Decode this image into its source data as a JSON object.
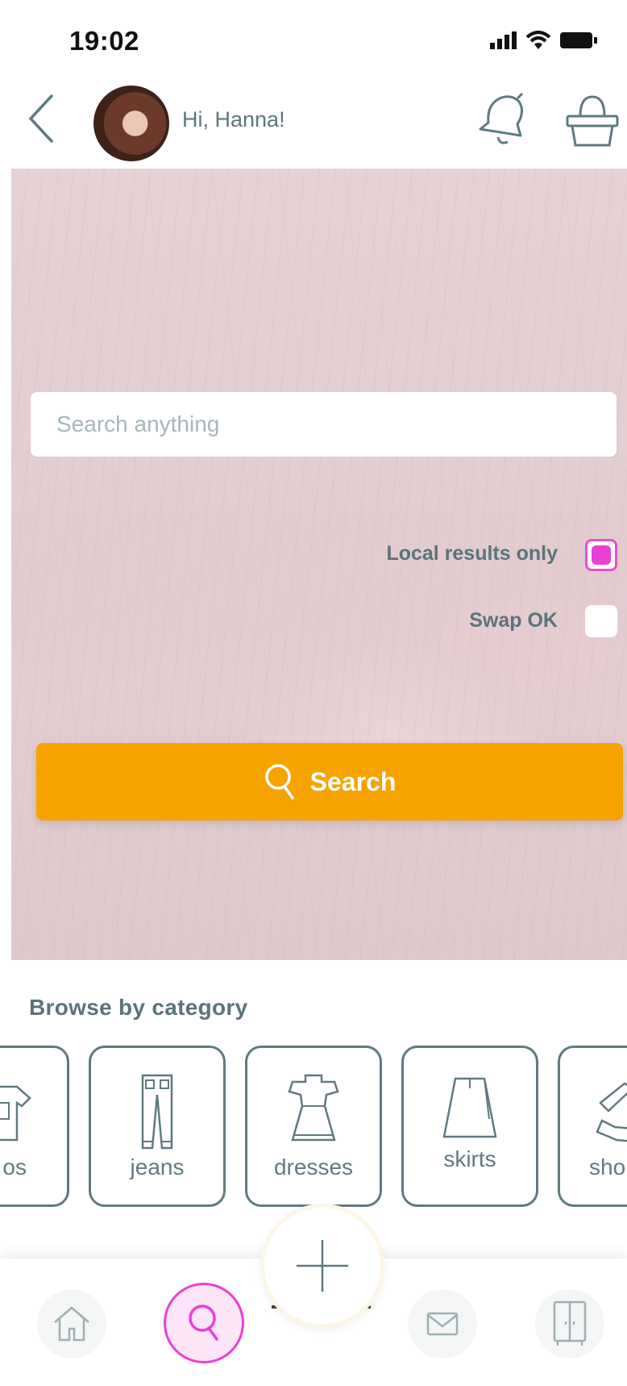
{
  "status_bar": {
    "time": "19:02"
  },
  "header": {
    "greeting": "Hi, Hanna!"
  },
  "search": {
    "placeholder": "Search anything",
    "options": [
      {
        "label": "Local results only",
        "checked": true
      },
      {
        "label": "Swap OK",
        "checked": false
      }
    ],
    "button_label": "Search"
  },
  "categories": {
    "title": "Browse by category",
    "items": [
      {
        "label": "os",
        "icon": "tops-icon"
      },
      {
        "label": "jeans",
        "icon": "jeans-icon"
      },
      {
        "label": "dresses",
        "icon": "dress-icon"
      },
      {
        "label": "skirts",
        "icon": "skirt-icon"
      },
      {
        "label": "sho",
        "icon": "shoes-icon"
      }
    ]
  },
  "colors": {
    "accent": "#f6a300",
    "highlight": "#ea3fd6",
    "text": "#5b737a"
  }
}
